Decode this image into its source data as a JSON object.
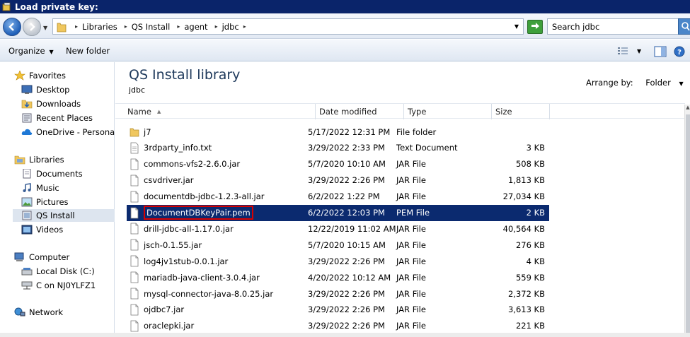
{
  "window": {
    "title": "Load private key:"
  },
  "address": {
    "breadcrumbs": [
      "Libraries",
      "QS Install",
      "agent",
      "jdbc"
    ],
    "search_placeholder": "Search jdbc"
  },
  "toolbar": {
    "organize": "Organize",
    "new_folder": "New folder"
  },
  "nav": {
    "favorites": {
      "label": "Favorites",
      "items": [
        "Desktop",
        "Downloads",
        "Recent Places",
        "OneDrive - Personal"
      ]
    },
    "libraries": {
      "label": "Libraries",
      "items": [
        "Documents",
        "Music",
        "Pictures",
        "QS Install",
        "Videos"
      ]
    },
    "computer": {
      "label": "Computer",
      "items": [
        "Local Disk (C:)",
        "C on NJ0YLFZ1"
      ]
    },
    "network": {
      "label": "Network"
    }
  },
  "content": {
    "title": "QS Install library",
    "subtitle": "jdbc",
    "arrange_label": "Arrange by:",
    "arrange_value": "Folder",
    "columns": [
      "Name",
      "Date modified",
      "Type",
      "Size"
    ],
    "files": [
      {
        "name": "j7",
        "date": "5/17/2022 12:31 PM",
        "type": "File folder",
        "size": "",
        "kind": "folder"
      },
      {
        "name": "3rdparty_info.txt",
        "date": "3/29/2022 2:33 PM",
        "type": "Text Document",
        "size": "3 KB",
        "kind": "txt"
      },
      {
        "name": "commons-vfs2-2.6.0.jar",
        "date": "5/7/2020 10:10 AM",
        "type": "JAR File",
        "size": "508 KB",
        "kind": "file"
      },
      {
        "name": "csvdriver.jar",
        "date": "3/29/2022 2:26 PM",
        "type": "JAR File",
        "size": "1,813 KB",
        "kind": "file"
      },
      {
        "name": "documentdb-jdbc-1.2.3-all.jar",
        "date": "6/2/2022 1:22 PM",
        "type": "JAR File",
        "size": "27,034 KB",
        "kind": "file"
      },
      {
        "name": "DocumentDBKeyPair.pem",
        "date": "6/2/2022 12:03 PM",
        "type": "PEM File",
        "size": "2 KB",
        "kind": "file",
        "selected": true
      },
      {
        "name": "drill-jdbc-all-1.17.0.jar",
        "date": "12/22/2019 11:02 AM",
        "type": "JAR File",
        "size": "40,564 KB",
        "kind": "file"
      },
      {
        "name": "jsch-0.1.55.jar",
        "date": "5/7/2020 10:15 AM",
        "type": "JAR File",
        "size": "276 KB",
        "kind": "file"
      },
      {
        "name": "log4jv1stub-0.0.1.jar",
        "date": "3/29/2022 2:26 PM",
        "type": "JAR File",
        "size": "4 KB",
        "kind": "file"
      },
      {
        "name": "mariadb-java-client-3.0.4.jar",
        "date": "4/20/2022 10:12 AM",
        "type": "JAR File",
        "size": "559 KB",
        "kind": "file"
      },
      {
        "name": "mysql-connector-java-8.0.25.jar",
        "date": "3/29/2022 2:26 PM",
        "type": "JAR File",
        "size": "2,372 KB",
        "kind": "file"
      },
      {
        "name": "ojdbc7.jar",
        "date": "3/29/2022 2:26 PM",
        "type": "JAR File",
        "size": "3,613 KB",
        "kind": "file"
      },
      {
        "name": "oraclepki.jar",
        "date": "3/29/2022 2:26 PM",
        "type": "JAR File",
        "size": "221 KB",
        "kind": "file"
      }
    ]
  },
  "colors": {
    "title_bar": "#0a246a",
    "selection": "#0b2a6f",
    "rename_border": "#d80000",
    "library_title": "#1e395b"
  }
}
